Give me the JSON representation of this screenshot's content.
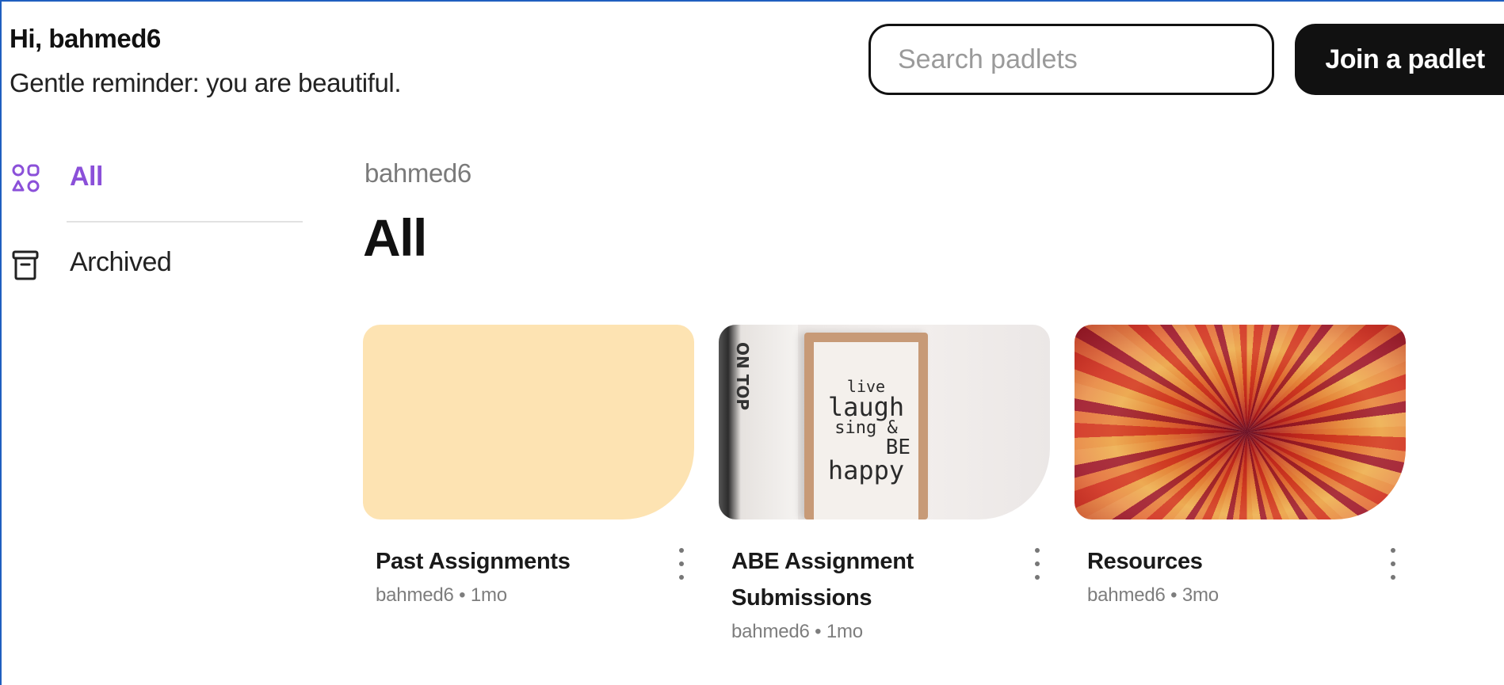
{
  "header": {
    "greeting": "Hi, bahmed6",
    "subgreeting": "Gentle reminder: you are beautiful.",
    "search_placeholder": "Search padlets",
    "join_label": "Join a padlet"
  },
  "sidebar": {
    "items": [
      {
        "label": "All",
        "icon": "shapes-icon",
        "active": true
      },
      {
        "label": "Archived",
        "icon": "archive-box-icon",
        "active": false
      }
    ]
  },
  "main": {
    "owner": "bahmed6",
    "title": "All",
    "cards": [
      {
        "title": "Past Assignments",
        "meta": "bahmed6 • 1mo",
        "thumb": "solid-yellow"
      },
      {
        "title": "ABE Assignment Submissions",
        "meta": "bahmed6 • 1mo",
        "thumb": "photo-live-laugh"
      },
      {
        "title": "Resources",
        "meta": "bahmed6 • 3mo",
        "thumb": "colorful-burst"
      }
    ],
    "photo_sign": [
      "live",
      "laugh",
      "sing &",
      "BE",
      "happy"
    ],
    "photo_book_spine": "ON TOP"
  },
  "colors": {
    "accent": "#8b50d9",
    "button_bg": "#111111",
    "card_yellow": "#fde3b2"
  }
}
